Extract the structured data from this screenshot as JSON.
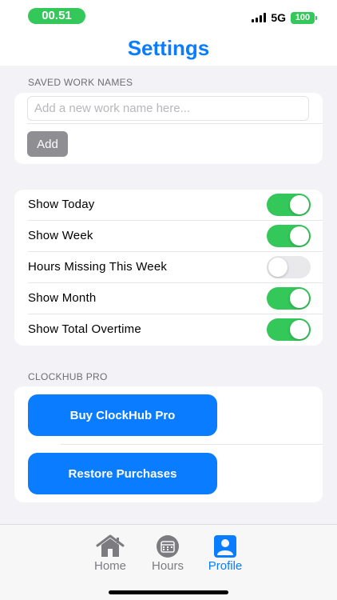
{
  "status_bar": {
    "time": "00.51",
    "network": "5G",
    "battery": "100",
    "time_pill_color": "#34c759",
    "battery_color": "#34c759"
  },
  "header": {
    "title": "Settings",
    "title_color": "#0a7cff"
  },
  "work_names": {
    "section_title": "SAVED WORK NAMES",
    "input_value": "",
    "input_placeholder": "Add a new work name here...",
    "add_label": "Add"
  },
  "display_options": [
    {
      "label": "Show Today",
      "on": true
    },
    {
      "label": "Show Week",
      "on": true
    },
    {
      "label": "Hours Missing This Week",
      "on": false
    },
    {
      "label": "Show Month",
      "on": true
    },
    {
      "label": "Show Total Overtime",
      "on": true
    }
  ],
  "pro": {
    "section_title": "CLOCKHUB PRO",
    "buy_label": "Buy ClockHub Pro",
    "restore_label": "Restore Purchases",
    "button_color": "#0a7cff"
  },
  "tab_bar": {
    "tabs": [
      {
        "label": "Home",
        "icon": "house-icon",
        "active": false
      },
      {
        "label": "Hours",
        "icon": "calendar-icon",
        "active": false
      },
      {
        "label": "Profile",
        "icon": "person-icon",
        "active": true
      }
    ],
    "active_color": "#0a7cff",
    "inactive_color": "#7c7c80"
  }
}
